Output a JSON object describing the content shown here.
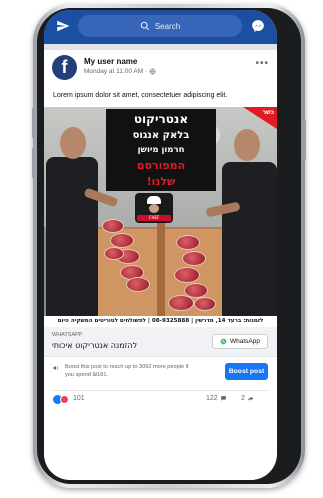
{
  "colors": {
    "topbar": "#1a4fa3",
    "search_bg": "#3765b8",
    "boost_button": "#1877f2",
    "sign_red": "#e11b24"
  },
  "topbar": {
    "left_icon": "send-icon",
    "search_placeholder": "Search",
    "right_icon": "messenger-icon"
  },
  "post": {
    "author": "My user name",
    "timestamp": "Monday at 11:00 AM",
    "visibility_icon": "globe-icon",
    "more_label": "•••",
    "text": "Lorem ipsum dolor sit amet, consectetuer adipiscing elit."
  },
  "image": {
    "corner_badge": "כשר",
    "sign_line1": "אנטריקוט",
    "sign_line2": "בלאק אנגוס",
    "sign_line3": "חרמון מיושן",
    "sign_line4": "המפורסם",
    "sign_line5": "שלנו!",
    "logo_band": "CHEF",
    "info_strip": "לזמנות: ברעד 14, מדרשין | 08-9325888 | לפשולחים לטוריטים המשקיה היום"
  },
  "link_preview": {
    "source": "WHATSAPP",
    "title": "להזמנה אנטריקוט איכותי",
    "button_label": "WhatsApp"
  },
  "boost": {
    "text": "Boost this post to reach up to 3092 more people if you spend ₪181.",
    "button_label": "Boost post"
  },
  "reactions": {
    "count": "101",
    "comments": "122",
    "shares": "2"
  }
}
